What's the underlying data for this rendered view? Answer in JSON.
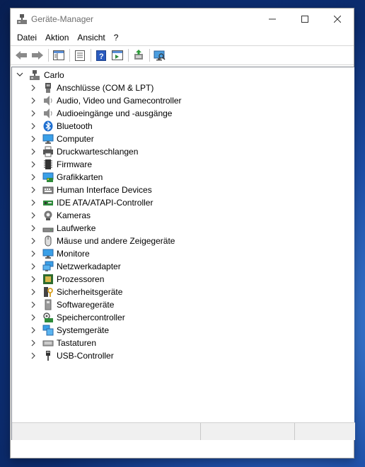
{
  "window": {
    "title": "Geräte-Manager"
  },
  "menu": [
    {
      "label": "Datei"
    },
    {
      "label": "Aktion"
    },
    {
      "label": "Ansicht"
    },
    {
      "label": "?"
    }
  ],
  "tree": {
    "root_label": "Carlo",
    "nodes": [
      {
        "label": "Anschlüsse (COM & LPT)",
        "icon": "port-icon"
      },
      {
        "label": "Audio, Video und Gamecontroller",
        "icon": "speaker-icon"
      },
      {
        "label": "Audioeingänge und -ausgänge",
        "icon": "speaker-icon"
      },
      {
        "label": "Bluetooth",
        "icon": "bluetooth-icon"
      },
      {
        "label": "Computer",
        "icon": "computer-icon"
      },
      {
        "label": "Druckwarteschlangen",
        "icon": "printer-icon"
      },
      {
        "label": "Firmware",
        "icon": "firmware-chip-icon"
      },
      {
        "label": "Grafikkarten",
        "icon": "display-adapter-icon"
      },
      {
        "label": "Human Interface Devices",
        "icon": "hid-keyboard-icon"
      },
      {
        "label": "IDE ATA/ATAPI-Controller",
        "icon": "ide-controller-icon"
      },
      {
        "label": "Kameras",
        "icon": "camera-icon"
      },
      {
        "label": "Laufwerke",
        "icon": "disk-drive-icon"
      },
      {
        "label": "Mäuse und andere Zeigegeräte",
        "icon": "mouse-icon"
      },
      {
        "label": "Monitore",
        "icon": "monitor-icon"
      },
      {
        "label": "Netzwerkadapter",
        "icon": "network-adapter-icon"
      },
      {
        "label": "Prozessoren",
        "icon": "processor-icon"
      },
      {
        "label": "Sicherheitsgeräte",
        "icon": "security-key-icon"
      },
      {
        "label": "Softwaregeräte",
        "icon": "software-device-icon"
      },
      {
        "label": "Speichercontroller",
        "icon": "storage-controller-icon"
      },
      {
        "label": "Systemgeräte",
        "icon": "system-device-icon"
      },
      {
        "label": "Tastaturen",
        "icon": "keyboard-icon"
      },
      {
        "label": "USB-Controller",
        "icon": "usb-icon"
      }
    ]
  },
  "colors": {
    "accent_blue": "#1f6fd0",
    "icon_gray": "#6b6b6b",
    "desktop_blue": "#1e4fa8"
  }
}
